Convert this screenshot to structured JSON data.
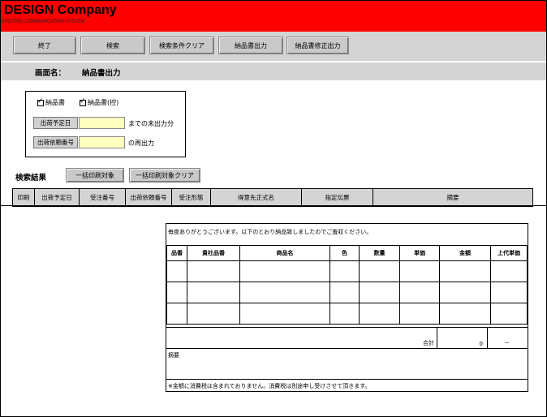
{
  "header": {
    "company": "DESIGN Company",
    "subtitle": "EXCITING COMMUNICATION SYSTEM"
  },
  "toolbar": [
    {
      "label": "終了"
    },
    {
      "label": "検索"
    },
    {
      "label": "検索条件クリア"
    },
    {
      "label": "納品書出力"
    },
    {
      "label": "納品書修正出力"
    }
  ],
  "screen": {
    "label": "画面名：",
    "name": "納品書出力"
  },
  "conditions": {
    "checkbox1": "納品書",
    "checkbox2": "納品書(控)",
    "ship_date_label": "出荷予定日",
    "ship_date_value": "",
    "ship_date_suffix": "までの未出力分",
    "order_no_label": "出荷依頼番号",
    "order_no_value": "",
    "order_no_suffix": "の再出力"
  },
  "results": {
    "label": "検索結果",
    "bulk_print": "一括印刷対象",
    "bulk_clear": "一括印刷対象クリア",
    "columns": [
      "印刷",
      "出荷予定日",
      "受注番号",
      "出荷依頼番号",
      "受注形態",
      "得意先正式名",
      "指定伝票",
      "摘要"
    ]
  },
  "slip": {
    "message": "毎度ありがとうございます。以下のとおり納品致しましたのでご査収ください。",
    "columns": [
      "品番",
      "貴社品番",
      "商品名",
      "色",
      "数量",
      "単価",
      "金額",
      "上代単価"
    ],
    "total_label": "合計",
    "total_amount": "0",
    "total_retail": "－",
    "memo_label": "摘要",
    "footnote": "※金額に消費税は含まれておりません。消費税は別途申し受けさせて頂きます。"
  }
}
